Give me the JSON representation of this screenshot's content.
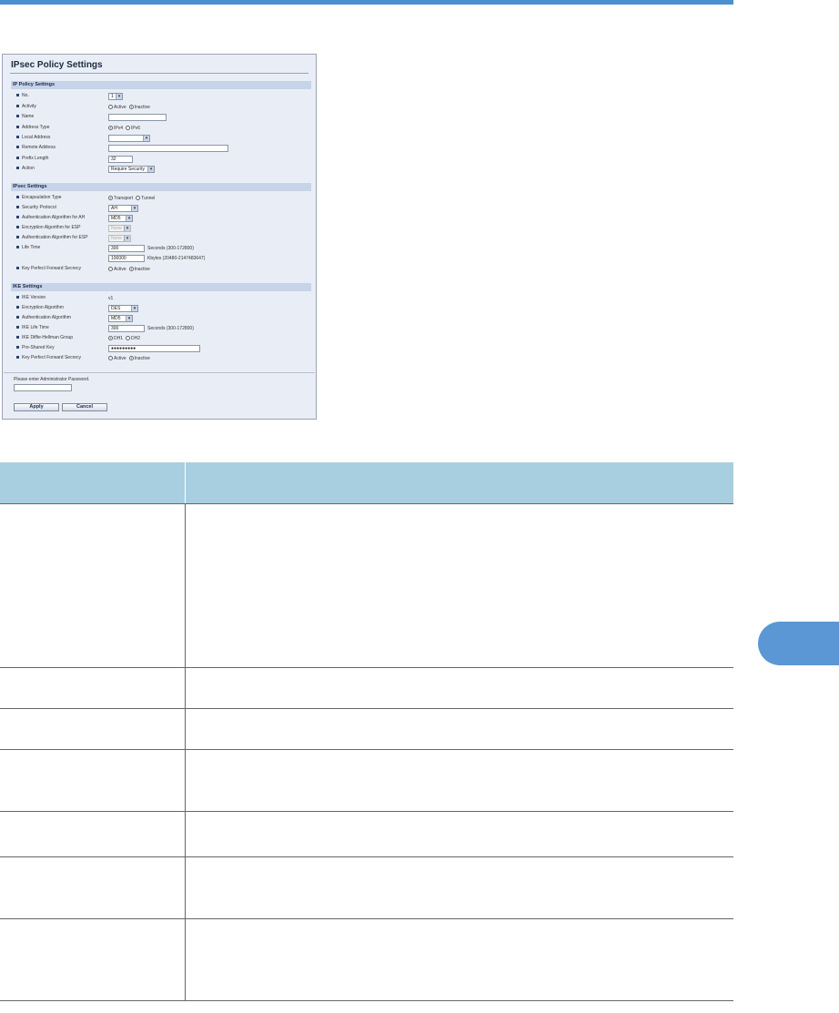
{
  "screen": {
    "title": "IPsec Policy Settings",
    "sections": {
      "ip_policy": {
        "heading": "IP Policy Settings",
        "rows": [
          {
            "label": "No.",
            "value": "1"
          },
          {
            "label": "Activity",
            "options": [
              "Active",
              "Inactive"
            ],
            "selected": "Inactive"
          },
          {
            "label": "Name",
            "value": ""
          },
          {
            "label": "Address Type",
            "options": [
              "IPv4",
              "IPv6"
            ],
            "selected": "IPv4"
          },
          {
            "label": "Local Address",
            "value": ""
          },
          {
            "label": "Remote Address",
            "value": ""
          },
          {
            "label": "Prefix Length",
            "value": "32"
          },
          {
            "label": "Action",
            "value": "Require Security"
          }
        ]
      },
      "ipsec": {
        "heading": "IPsec Settings",
        "rows": [
          {
            "label": "Encapsulation Type",
            "options": [
              "Transport",
              "Tunnel"
            ],
            "selected": "Transport"
          },
          {
            "label": "Security Protocol",
            "value": "AH"
          },
          {
            "label": "Authentication Algorithm for AH",
            "value": "MD5"
          },
          {
            "label": "Encryption Algorithm for ESP",
            "value": "None"
          },
          {
            "label": "Authentication Algorithm for ESP",
            "value": "None"
          },
          {
            "label": "Life Time",
            "value": "300",
            "suffix": "Seconds (300-172800)"
          },
          {
            "label": "",
            "value": "100000",
            "suffix": "Kbytes (20480-2147483647)"
          },
          {
            "label": "Key Perfect Forward Secrecy",
            "options": [
              "Active",
              "Inactive"
            ],
            "selected": "Inactive"
          }
        ]
      },
      "ike": {
        "heading": "IKE Settings",
        "rows": [
          {
            "label": "IKE Version",
            "value": "v1"
          },
          {
            "label": "Encryption Algorithm",
            "value": "DES"
          },
          {
            "label": "Authentication Algorithm",
            "value": "MD5"
          },
          {
            "label": "IKE Life Time",
            "value": "300",
            "suffix": "Seconds (300-172800)"
          },
          {
            "label": "IKE Diffie-Hellman Group",
            "options": [
              "DH1",
              "DH2"
            ],
            "selected": "DH1"
          },
          {
            "label": "Pre-Shared Key",
            "value": "●●●●●●●●●"
          },
          {
            "label": "Key Perfect Forward Secrecy",
            "options": [
              "Active",
              "Inactive"
            ],
            "selected": "Inactive"
          }
        ]
      }
    },
    "password_prompt": "Please enter Administrator Password.",
    "buttons": {
      "apply": "Apply",
      "cancel": "Cancel"
    }
  },
  "colors": {
    "accent": "#4a8fd0",
    "table_header": "#a8cfe0",
    "side_tab": "#5b97d4"
  }
}
